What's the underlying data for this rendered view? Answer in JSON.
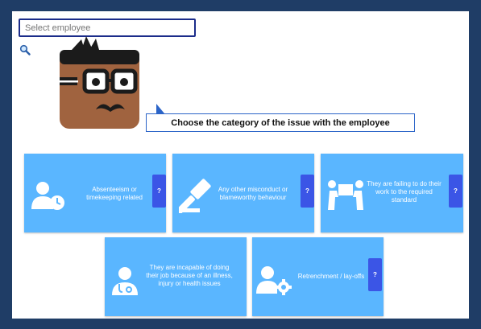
{
  "employee_select": {
    "placeholder": "Select employee"
  },
  "prompt": {
    "text": "Choose the category of the issue with the employee"
  },
  "categories": [
    {
      "label": "Absenteeism or timekeeping related",
      "icon": "person-clock-icon",
      "help": "?"
    },
    {
      "label": "Any other misconduct or blameworthy behaviour",
      "icon": "gavel-icon",
      "help": "?"
    },
    {
      "label": "They are failing to do their work to the required standard",
      "icon": "people-lifting-box-icon",
      "help": "?"
    },
    {
      "label": "They are incapable of doing their job because of an illness, injury or health issues",
      "icon": "doctor-icon",
      "help": ""
    },
    {
      "label": "Retrenchment / lay-offs",
      "icon": "person-gear-icon",
      "help": "?"
    }
  ],
  "colors": {
    "frame": "#1f3d66",
    "tile": "#5ab6ff",
    "help_button": "#3b55e6",
    "select_border": "#1b2c8a",
    "bubble_border": "#2b64c8"
  }
}
